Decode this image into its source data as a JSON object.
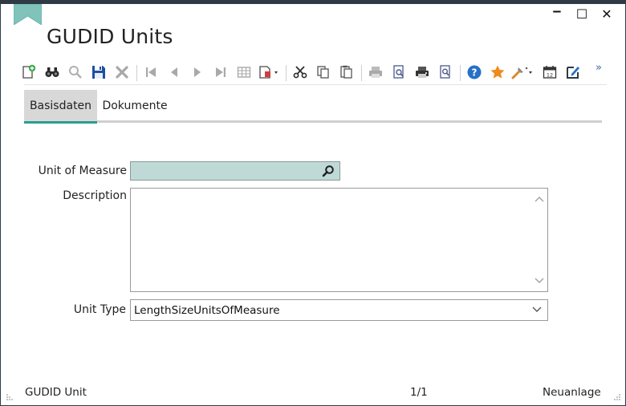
{
  "window": {
    "title": "GUDID Units",
    "controls": {
      "minimize": "‒",
      "maximize": "☐",
      "close": "✕"
    }
  },
  "toolbar": {
    "icons": [
      "new-record-icon",
      "find-icon",
      "lookup-icon",
      "save-icon",
      "delete-icon",
      "first-record-icon",
      "previous-record-icon",
      "next-record-icon",
      "last-record-icon",
      "grid-view-icon",
      "report-icon",
      "cut-icon",
      "copy-icon",
      "paste-icon",
      "print-icon",
      "print-preview-icon",
      "print-setup-icon",
      "preview-icon",
      "help-icon",
      "favorite-icon",
      "tools-icon",
      "calendar-icon",
      "edit-icon"
    ],
    "more_label": "»"
  },
  "tabs": [
    {
      "label": "Basisdaten",
      "active": true
    },
    {
      "label": "Dokumente",
      "active": false
    }
  ],
  "form": {
    "uom_label": "Unit of Measure",
    "uom_value": "",
    "description_label": "Description",
    "description_value": "",
    "unit_type_label": "Unit Type",
    "unit_type_value": "LengthSizeUnitsOfMeasure"
  },
  "status_bar": {
    "left": "GUDID Unit",
    "record_position": "1/1",
    "mode": "Neuanlage"
  },
  "colors": {
    "accent": "#2a9d8f",
    "uom_field_bg": "#bfd9d6",
    "frame": "#2f3a45",
    "save_blue": "#1f4fa3",
    "help_blue": "#2670c7",
    "favorite_orange": "#f08a1c"
  }
}
